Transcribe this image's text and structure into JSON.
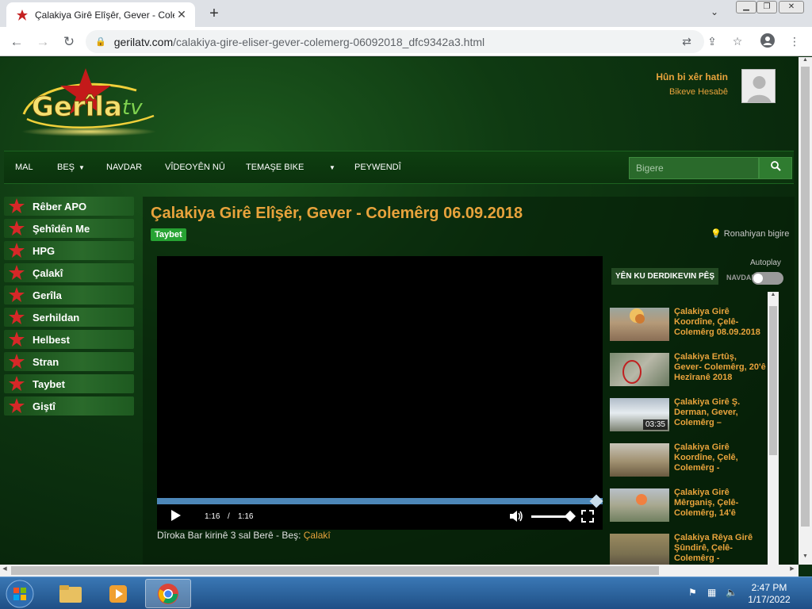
{
  "browser": {
    "tab_title": "Çalakiya Girê Elîşêr, Gever - Cole",
    "url_domain": "gerilatv.com",
    "url_path": "/calakiya-gire-eliser-gever-colemerg-06092018_dfc9342a3.html",
    "close_tab": "✕",
    "new_tab": "+",
    "tab_menu": "⌄"
  },
  "site": {
    "logo_text_main": "Gerîla",
    "logo_text_accent": "tv",
    "login_title": "Hûn bi xêr hatin",
    "login_link": "Bikeve Hesabê"
  },
  "nav": {
    "items": [
      "MAL",
      "BEŞ",
      "NAVDAR",
      "VÎDEOYÊN NÛ",
      "TEMAŞE BIKE",
      "",
      "PEYWENDÎ"
    ],
    "search_placeholder": "Bigere"
  },
  "sidebar": {
    "items": [
      "Rêber APO",
      "Şehîdên Me",
      "HPG",
      "Çalakî",
      "Gerîla",
      "Serhildan",
      "Helbest",
      "Stran",
      "Taybet",
      "Giştî"
    ]
  },
  "video": {
    "title": "Çalakiya Girê Elîşêr, Gever - Colemêrg 06.09.2018",
    "badge": "Taybet",
    "location": "Ronahiyan bigire",
    "current_time": "1:16",
    "separator": "/",
    "duration": "1:16",
    "progress_percent": 100,
    "volume_percent": 100,
    "caption_prefix": "Dîroka Bar kirinê 3 sal Berê - Beş:",
    "caption_category": "Çalakî"
  },
  "related": {
    "autoplay_label": "Autoplay",
    "next_label": "YÊN KU DERDIKEVIN PÊŞ",
    "toggle_label": "NAVDAR",
    "items": [
      {
        "title": "Çalakiya Girê Koordîne, Çelê-Colemêrg 08.09.2018",
        "duration": ""
      },
      {
        "title": "Çalakiya Ertûş, Gever- Colemêrg, 20'ê Hezîranê 2018",
        "duration": ""
      },
      {
        "title": "Çalakiya Girê Ş. Derman, Gever, Colemêrg –",
        "duration": "03:35"
      },
      {
        "title": "Çalakiya Girê Koordîne, Çelê, Colemêrg -",
        "duration": ""
      },
      {
        "title": "Çalakiya Girê Mêrganiş, Çelê-Colemêrg, 14'ê",
        "duration": ""
      },
      {
        "title": "Çalakiya Rêya Girê Şûndirê, Çelê-Colemêrg -",
        "duration": ""
      }
    ]
  },
  "taskbar": {
    "time": "2:47 PM",
    "date": "1/17/2022"
  },
  "colors": {
    "accent": "#e8a33c",
    "badge": "#27a333",
    "page_bg": "#0f3a12"
  }
}
